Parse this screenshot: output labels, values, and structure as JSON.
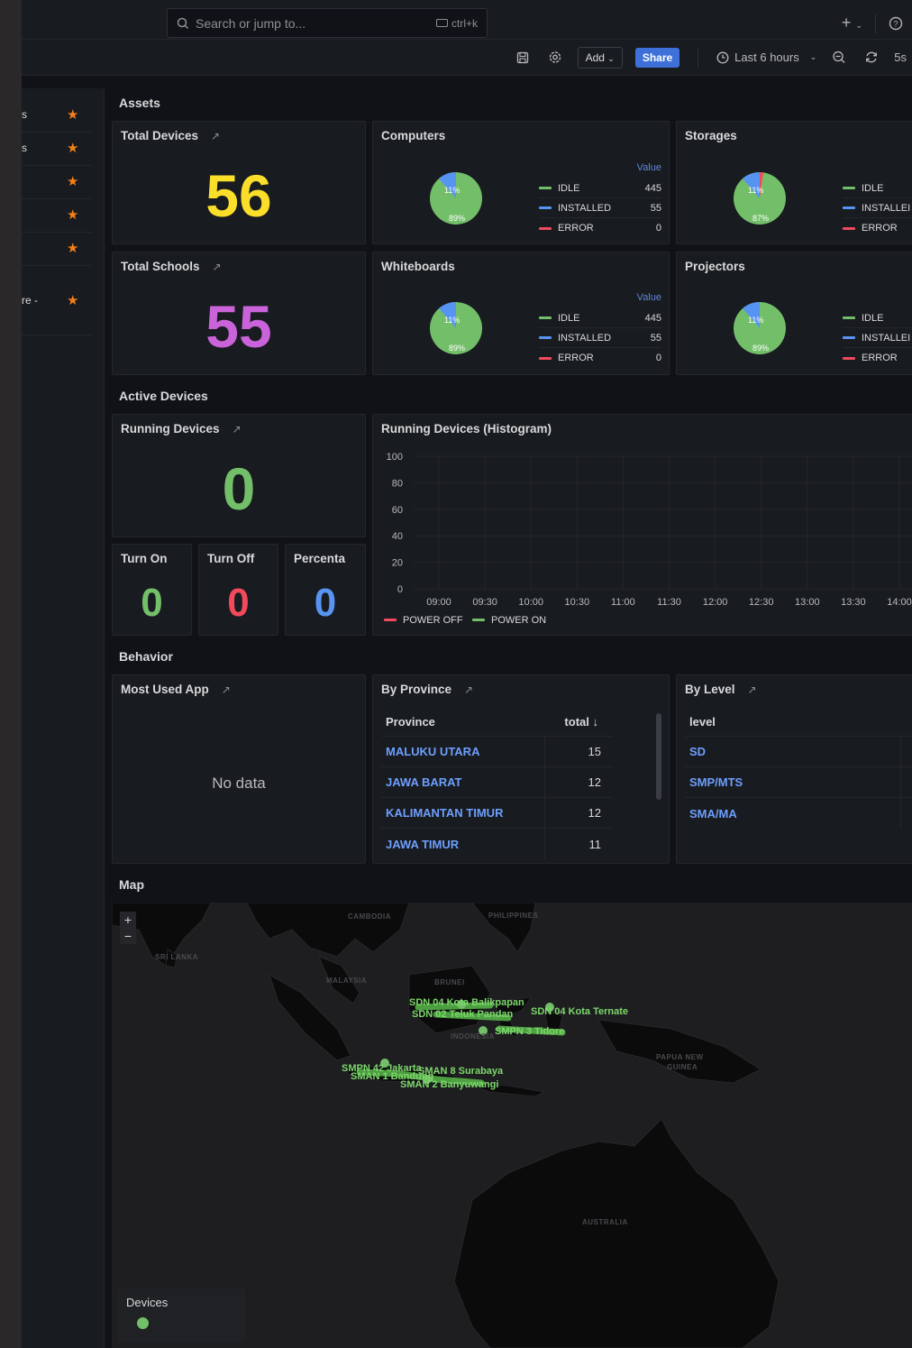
{
  "topbar": {
    "search_placeholder": "Search or jump to...",
    "search_shortcut": "ctrl+k",
    "plus_label": "+",
    "help_icon": "help-circle-icon"
  },
  "toolbar": {
    "add_label": "Add",
    "share_label": "Share",
    "time_range": "Last 6 hours",
    "refresh_interval": "5s"
  },
  "sidebar": {
    "items": [
      {
        "label": "s"
      },
      {
        "label": "s"
      },
      {
        "label": ""
      },
      {
        "label": ""
      },
      {
        "label": ""
      },
      {
        "label": "re -"
      }
    ]
  },
  "sections": {
    "assets": "Assets",
    "active_devices": "Active Devices",
    "behavior": "Behavior",
    "map": "Map"
  },
  "stats": {
    "total_devices": {
      "title": "Total Devices",
      "value": "56",
      "color": "#fade2a"
    },
    "total_schools": {
      "title": "Total Schools",
      "value": "55",
      "color": "#ca63d9"
    },
    "running_devices": {
      "title": "Running Devices",
      "value": "0",
      "color": "#73bf69"
    },
    "turn_on": {
      "title": "Turn On",
      "value": "0",
      "color": "#73bf69"
    },
    "turn_off": {
      "title": "Turn Off",
      "value": "0",
      "color": "#f2495c"
    },
    "percenta": {
      "title": "Percenta",
      "value": "0",
      "color": "#5794f2"
    }
  },
  "pies": {
    "computers": {
      "title": "Computers",
      "header": "Value",
      "idle": "445",
      "installed": "55",
      "error": "0",
      "pct_small": "11%",
      "pct_large": "89%"
    },
    "storages": {
      "title": "Storages",
      "pct_small": "11%",
      "pct_large": "87%"
    },
    "whiteboards": {
      "title": "Whiteboards",
      "header": "Value",
      "idle": "445",
      "installed": "55",
      "error": "0",
      "pct_small": "11%",
      "pct_large": "89%"
    },
    "projectors": {
      "title": "Projectors",
      "pct_small": "11%",
      "pct_large": "89%"
    },
    "legend": {
      "idle": "IDLE",
      "installed": "INSTALLED",
      "installed_clipped": "INSTALLEI",
      "error": "ERROR"
    },
    "colors": {
      "idle": "#73bf69",
      "installed": "#5794f2",
      "error": "#f2495c"
    }
  },
  "chart_data": {
    "type": "line",
    "title": "Running Devices (Histogram)",
    "x": [
      "09:00",
      "09:30",
      "10:00",
      "10:30",
      "11:00",
      "11:30",
      "12:00",
      "12:30",
      "13:00",
      "13:30",
      "14:00"
    ],
    "y_ticks": [
      "100",
      "80",
      "60",
      "40",
      "20",
      "0"
    ],
    "ylim": [
      0,
      100
    ],
    "series": [
      {
        "name": "POWER OFF",
        "color": "#f2495c",
        "values": []
      },
      {
        "name": "POWER ON",
        "color": "#73bf69",
        "values": []
      }
    ]
  },
  "behavior": {
    "most_used": {
      "title": "Most Used App",
      "empty": "No data"
    },
    "by_province": {
      "title": "By Province",
      "col1": "Province",
      "col2": "total",
      "rows": [
        {
          "name": "MALUKU UTARA",
          "total": "15"
        },
        {
          "name": "JAWA BARAT",
          "total": "12"
        },
        {
          "name": "KALIMANTAN TIMUR",
          "total": "12"
        },
        {
          "name": "JAWA TIMUR",
          "total": "11"
        }
      ]
    },
    "by_level": {
      "title": "By Level",
      "col1": "level",
      "rows": [
        {
          "name": "SD"
        },
        {
          "name": "SMP/MTS"
        },
        {
          "name": "SMA/MA"
        }
      ]
    }
  },
  "map": {
    "legend_title": "Devices",
    "zoom_in": "+",
    "zoom_out": "−",
    "labels": {
      "cambodia": "CAMBODIA",
      "philippines": "PHILIPPINES",
      "sri_lanka": "SRI LANKA",
      "malaysia": "MALAYSIA",
      "brunei": "BRUNEI",
      "indonesia": "INDONESIA",
      "papua": "PAPUA NEW",
      "guinea": "GUINEA",
      "australia": "AUSTRALIA"
    },
    "markers": {
      "m1": "SDN 04 Kota Ternate",
      "m2": "SDN 02 Teluk Pandan",
      "m3": "SMPN 42 Jakarta",
      "m4": "SMAN 8 Surabaya",
      "m5": "SMAN 2 Banyuwangi",
      "m6": "SDN 04 Kota Balikpapan",
      "m7": "SMPN 3 Tidore",
      "m8": "SMAN 1 Bandung"
    }
  }
}
